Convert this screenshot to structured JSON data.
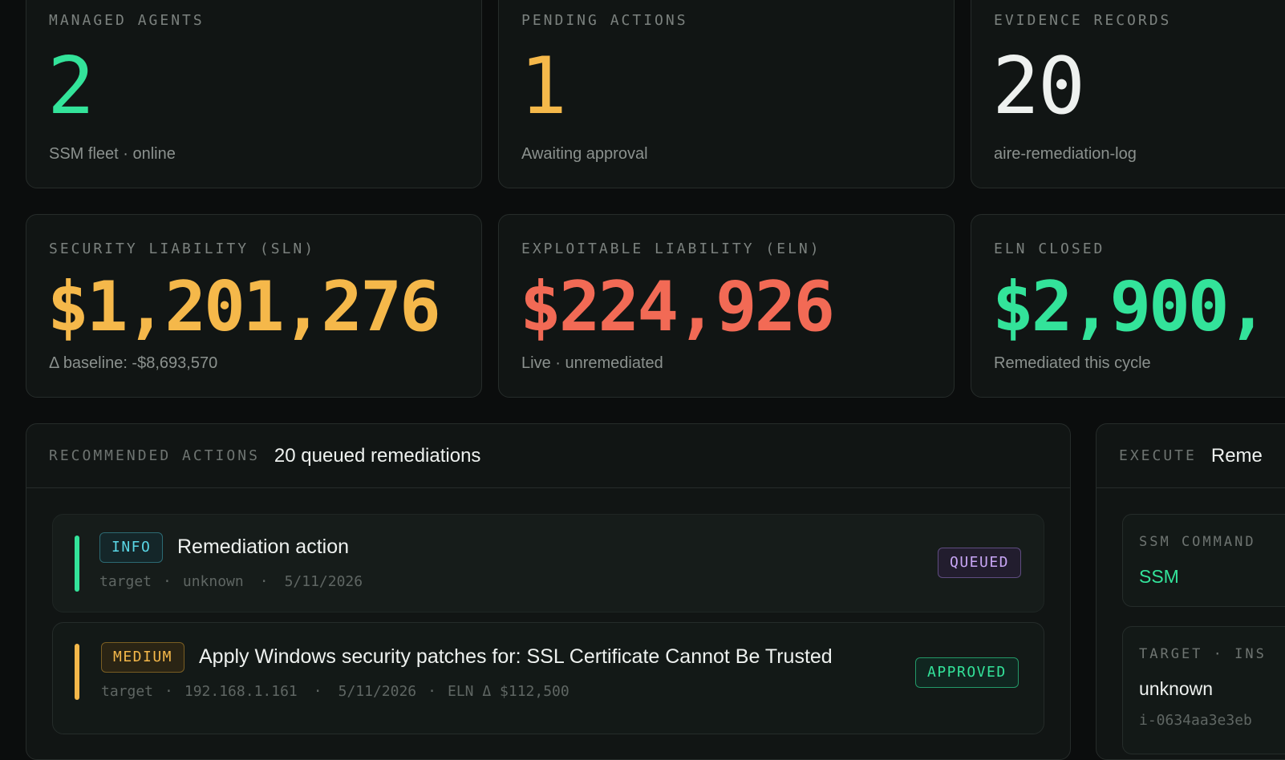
{
  "stats_row1": [
    {
      "label": "MANAGED AGENTS",
      "value": "2",
      "sub": "SSM fleet · online",
      "color": "#33e39a"
    },
    {
      "label": "PENDING ACTIONS",
      "value": "1",
      "sub": "Awaiting approval",
      "color": "#f5b84a"
    },
    {
      "label": "EVIDENCE RECORDS",
      "value": "20",
      "sub": "aire-remediation-log",
      "color": "#eef1ef"
    }
  ],
  "stats_row2": [
    {
      "label": "SECURITY LIABILITY (SLN)",
      "value": "$1,201,276",
      "sub": "Δ baseline: -$8,693,570",
      "color": "#f5b84a"
    },
    {
      "label": "EXPLOITABLE LIABILITY (ELN)",
      "value": "$224,926",
      "sub": "Live · unremediated",
      "color": "#f26a55"
    },
    {
      "label": "ELN CLOSED",
      "value": "$2,900,",
      "sub": "Remediated this cycle",
      "color": "#33e39a"
    }
  ],
  "recommended": {
    "key": "RECOMMENDED ACTIONS",
    "title": "20 queued remediations",
    "items": [
      {
        "severity": "INFO",
        "title": "Remediation action",
        "target_label": "target",
        "target": "unknown",
        "date": "5/11/2026",
        "eln": "",
        "status": "QUEUED",
        "accent": "#33e39a"
      },
      {
        "severity": "MEDIUM",
        "title": "Apply Windows security patches for: SSL Certificate Cannot Be Trusted",
        "target_label": "target",
        "target": "192.168.1.161",
        "date": "5/11/2026",
        "eln": "ELN Δ $112,500",
        "status": "APPROVED",
        "accent": "#f5b84a"
      }
    ]
  },
  "execute": {
    "key": "EXECUTE",
    "title": "Reme",
    "ssm_command_label": "SSM COMMAND",
    "ssm_command_value": "SSM",
    "target_label": "TARGET · INS",
    "target_value": "unknown",
    "instance_id": "i-0634aa3e3eb"
  }
}
